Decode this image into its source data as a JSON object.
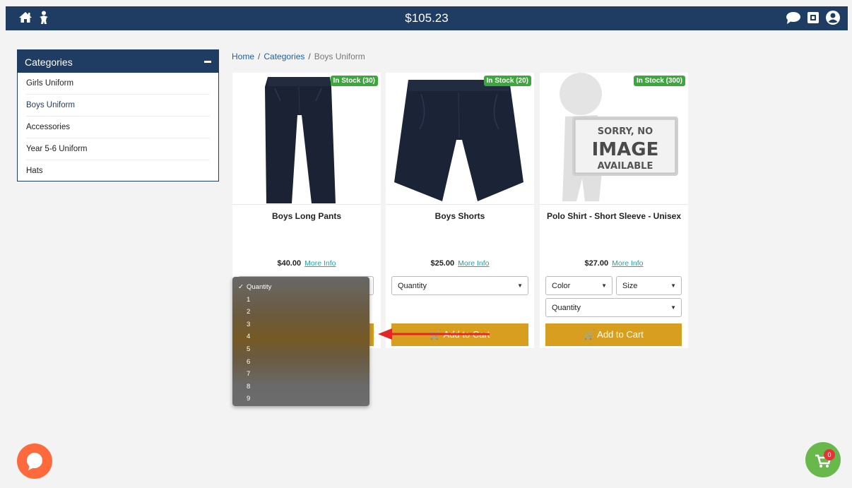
{
  "header": {
    "balance": "$105.23",
    "icons": [
      "home-icon",
      "student-icon",
      "chat-icon",
      "frame-icon",
      "user-icon"
    ]
  },
  "sidebar": {
    "title": "Categories",
    "items": [
      {
        "label": "Girls Uniform"
      },
      {
        "label": "Boys Uniform"
      },
      {
        "label": "Accessories"
      },
      {
        "label": "Year 5-6 Uniform"
      },
      {
        "label": "Hats"
      }
    ]
  },
  "breadcrumb": {
    "home": "Home",
    "sep1": "/",
    "categories": "Categories",
    "sep2": "/",
    "current": "Boys Uniform"
  },
  "products": [
    {
      "name": "Boys Long Pants",
      "stock": "In Stock (30)",
      "price": "$40.00",
      "more": "More Info"
    },
    {
      "name": "Boys Shorts",
      "stock": "In Stock (20)",
      "price": "$25.00",
      "more": "More Info",
      "quantity_placeholder": "Quantity",
      "cart_label": "Add to Cart"
    },
    {
      "name": "Polo Shirt - Short Sleeve - Unisex",
      "stock": "In Stock (300)",
      "price": "$27.00",
      "more": "More Info",
      "color_placeholder": "Color",
      "size_placeholder": "Size",
      "quantity_placeholder": "Quantity",
      "cart_label": "Add to Cart",
      "image_text": [
        "SORRY, NO",
        "IMAGE",
        "AVAILABLE"
      ]
    }
  ],
  "dropdown": {
    "check": "✓",
    "options": [
      "Quantity",
      "1",
      "2",
      "3",
      "4",
      "5",
      "6",
      "7",
      "8",
      "9"
    ]
  },
  "cart": {
    "count": "0"
  },
  "colors": {
    "navy": "#1f3d63",
    "gold": "#d79e1f",
    "stock_green": "#3aa83a",
    "link_teal": "#1aa6a6",
    "chat_orange": "#ff6a3d",
    "cart_green": "#69b84c",
    "annotation_red": "#e52525"
  }
}
